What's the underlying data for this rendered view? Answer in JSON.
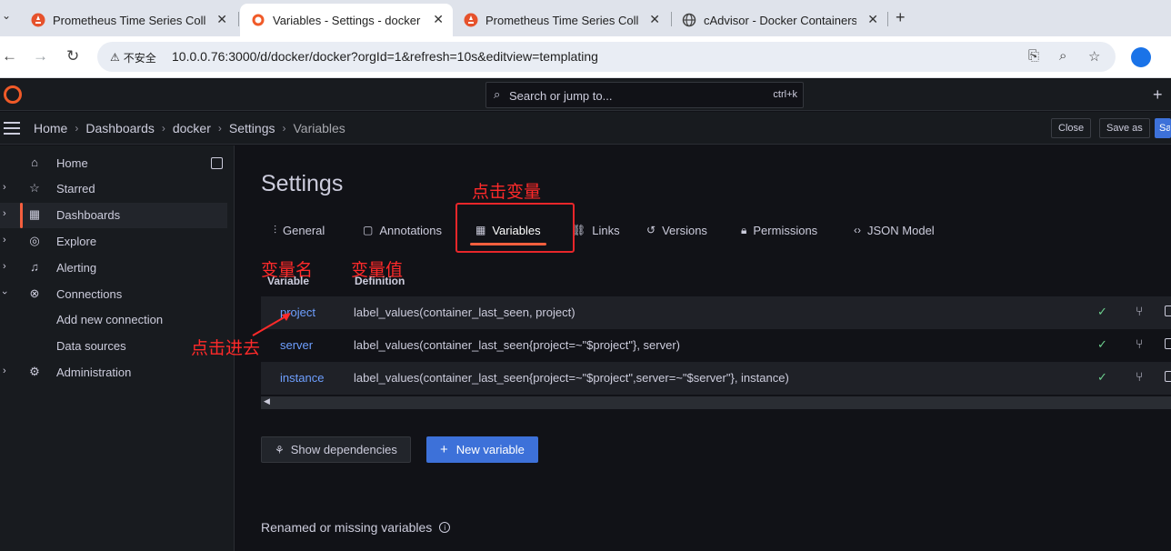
{
  "browser": {
    "tabs": [
      {
        "title": "Prometheus Time Series Collec",
        "icon": "prometheus-icon"
      },
      {
        "title": "Variables - Settings - docker",
        "icon": "grafana-icon",
        "active": true
      },
      {
        "title": "Prometheus Time Series Collec",
        "icon": "prometheus-icon"
      },
      {
        "title": "cAdvisor - Docker Containers",
        "icon": "globe-icon"
      }
    ],
    "security_label": "不安全",
    "url": "10.0.0.76:3000/d/docker/docker?orgId=1&refresh=10s&editview=templating"
  },
  "grafana": {
    "search_placeholder": "Search or jump to...",
    "search_shortcut": "ctrl+k",
    "breadcrumbs": [
      "Home",
      "Dashboards",
      "docker",
      "Settings",
      "Variables"
    ],
    "buttons": {
      "close": "Close",
      "save_as": "Save as",
      "save": "Sa"
    },
    "sidebar": [
      {
        "label": "Home",
        "icon": "home-icon",
        "expandable": false
      },
      {
        "label": "Starred",
        "icon": "star-icon",
        "expandable": true
      },
      {
        "label": "Dashboards",
        "icon": "dashboards-icon",
        "expandable": true,
        "active": true
      },
      {
        "label": "Explore",
        "icon": "compass-icon",
        "expandable": true
      },
      {
        "label": "Alerting",
        "icon": "bell-icon",
        "expandable": true
      },
      {
        "label": "Connections",
        "icon": "connections-icon",
        "expandable": true,
        "expanded": true
      },
      {
        "label": "Add new connection",
        "icon": "",
        "expandable": false
      },
      {
        "label": "Data sources",
        "icon": "",
        "expandable": false
      },
      {
        "label": "Administration",
        "icon": "gear-icon",
        "expandable": true
      }
    ],
    "settings": {
      "title": "Settings",
      "tabs": [
        {
          "label": "General",
          "icon": "sliders-icon"
        },
        {
          "label": "Annotations",
          "icon": "comment-icon"
        },
        {
          "label": "Variables",
          "icon": "calculator-icon",
          "active": true
        },
        {
          "label": "Links",
          "icon": "link-icon"
        },
        {
          "label": "Versions",
          "icon": "history-icon"
        },
        {
          "label": "Permissions",
          "icon": "lock-icon"
        },
        {
          "label": "JSON Model",
          "icon": "code-icon"
        }
      ],
      "table_headers": {
        "variable": "Variable",
        "definition": "Definition"
      },
      "variables": [
        {
          "name": "project",
          "definition": "label_values(container_last_seen, project)"
        },
        {
          "name": "server",
          "definition": "label_values(container_last_seen{project=~\"$project\"}, server)"
        },
        {
          "name": "instance",
          "definition": "label_values(container_last_seen{project=~\"$project\",server=~\"$server\"}, instance)"
        }
      ],
      "show_dependencies": "Show dependencies",
      "new_variable": "New variable",
      "renamed_missing": "Renamed or missing variables"
    }
  },
  "annotations": {
    "click_variables": "点击变量",
    "variable_name": "变量名",
    "variable_value": "变量值",
    "click_enter": "点击进去"
  },
  "colors": {
    "accent": "#f55f3e",
    "link": "#6e9fff",
    "primary_button": "#3d71d9",
    "annotation": "#ff2a2a",
    "ok": "#6ccf8e"
  }
}
